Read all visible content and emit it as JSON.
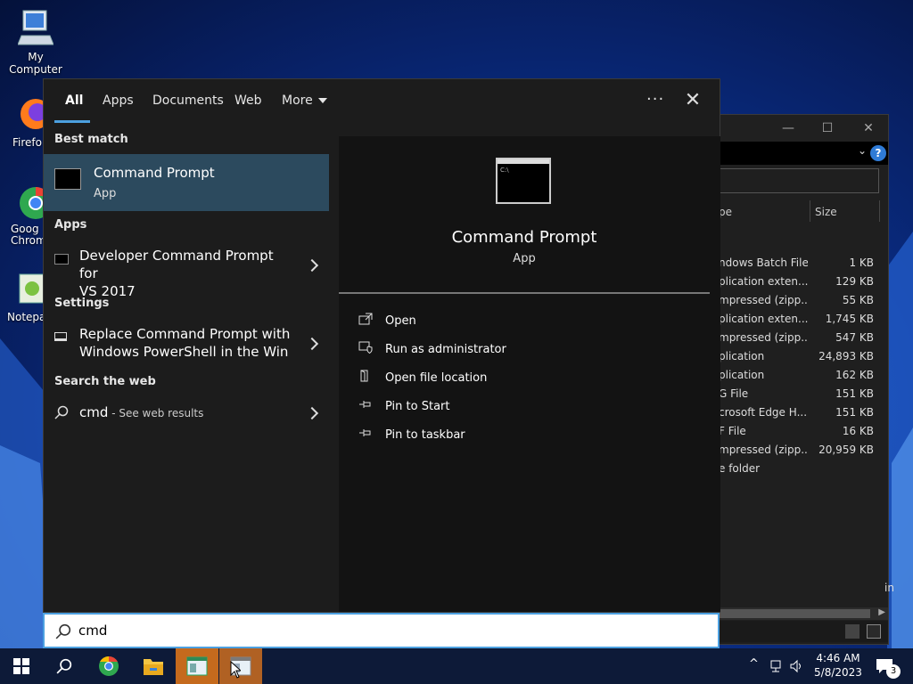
{
  "desktop": {
    "icons": [
      {
        "label": "My Computer"
      },
      {
        "label": "Firefo"
      },
      {
        "label": "Goog Chrom"
      },
      {
        "label": "Notepa"
      }
    ]
  },
  "explorer": {
    "help_label": "?",
    "column_type": "pe",
    "column_size": "Size",
    "rows": [
      {
        "type": "ndows Batch File",
        "size": "1 KB"
      },
      {
        "type": "plication exten...",
        "size": "129 KB"
      },
      {
        "type": "mpressed (zipp...",
        "size": "55 KB"
      },
      {
        "type": "plication exten...",
        "size": "1,745 KB"
      },
      {
        "type": "mpressed (zipp...",
        "size": "547 KB"
      },
      {
        "type": "plication",
        "size": "24,893 KB"
      },
      {
        "type": "plication",
        "size": "162 KB"
      },
      {
        "type": "G File",
        "size": "151 KB"
      },
      {
        "type": "crosoft Edge H...",
        "size": "151 KB"
      },
      {
        "type": "F File",
        "size": "16 KB"
      },
      {
        "type": "mpressed (zipp...",
        "size": "20,959 KB"
      },
      {
        "type": "e folder",
        "size": ""
      }
    ],
    "side_text": "in"
  },
  "search_panel": {
    "tabs": [
      {
        "label": "All",
        "active": true
      },
      {
        "label": "Apps"
      },
      {
        "label": "Documents"
      },
      {
        "label": "Web"
      },
      {
        "label": "More"
      }
    ],
    "dots": "···",
    "close": "✕",
    "best_match_header": "Best match",
    "best_match": {
      "title": "Command Prompt",
      "subtitle": "App"
    },
    "apps_header": "Apps",
    "apps_item": {
      "line1": "Developer Command Prompt for",
      "line2": "VS 2017"
    },
    "settings_header": "Settings",
    "settings_item": {
      "line1": "Replace Command Prompt with",
      "line2": "Windows PowerShell in the Win"
    },
    "web_header": "Search the web",
    "web_item": {
      "query": "cmd",
      "suffix": " - See web results"
    },
    "preview": {
      "title": "Command Prompt",
      "subtitle": "App",
      "actions": [
        {
          "label": "Open",
          "icon": "open-icon"
        },
        {
          "label": "Run as administrator",
          "icon": "admin-shield-icon"
        },
        {
          "label": "Open file location",
          "icon": "file-location-icon"
        },
        {
          "label": "Pin to Start",
          "icon": "pin-icon"
        },
        {
          "label": "Pin to taskbar",
          "icon": "pin-icon"
        }
      ]
    }
  },
  "search_box": {
    "value": "cmd"
  },
  "taskbar": {
    "time": "4:46 AM",
    "date": "5/8/2023",
    "notification_count": "3"
  },
  "colors": {
    "accent": "#4ca0e0",
    "selection": "#2c4a5e",
    "taskbar_active": "#c56a1d"
  }
}
